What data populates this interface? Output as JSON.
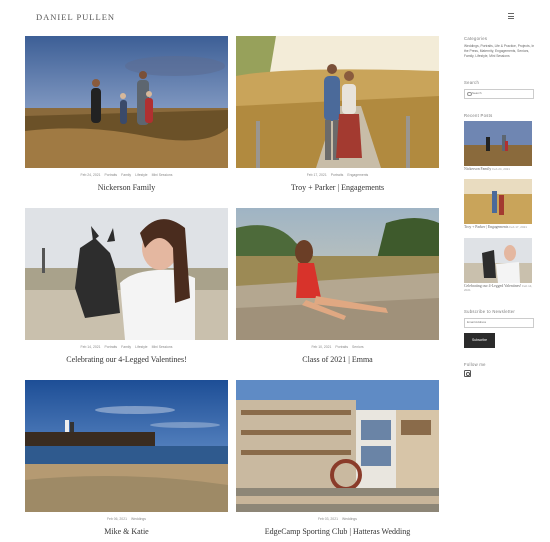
{
  "site": {
    "title": "DANIEL PULLEN"
  },
  "posts": [
    {
      "title": "Nickerson Family",
      "date": "Feb 24, 2021",
      "tags": [
        "Portraits",
        "Family",
        "Lifestyle",
        "Mini Sessions"
      ]
    },
    {
      "title": "Troy + Parker | Engagements",
      "date": "Feb 17, 2021",
      "tags": [
        "Portraits",
        "Engagements"
      ]
    },
    {
      "title": "Celebrating our 4-Legged Valentines!",
      "date": "Feb 14, 2021",
      "tags": [
        "Portraits",
        "Family",
        "Lifestyle",
        "Mini Sessions"
      ]
    },
    {
      "title": "Class of 2021 | Emma",
      "date": "Feb 10, 2021",
      "tags": [
        "Portraits",
        "Seniors"
      ]
    },
    {
      "title": "Mike & Katie",
      "date": "Feb 06, 2021",
      "tags": [
        "Weddings"
      ]
    },
    {
      "title": "EdgeCamp Sporting Club | Hatteras Wedding",
      "date": "Feb 03, 2021",
      "tags": [
        "Weddings"
      ]
    }
  ],
  "sidebar": {
    "categories_title": "Categories",
    "categories": [
      "Weddings",
      "Portraits",
      "Life & Practice",
      "Projects",
      "In the Press",
      "Maternity",
      "Engagements",
      "Seniors",
      "Family",
      "Lifestyle",
      "Mini Sessions"
    ],
    "search_title": "Search",
    "search_placeholder": "Search",
    "recent_title": "Recent Posts",
    "recent": [
      {
        "title": "Nickerson Family",
        "date": "Feb 24, 2021"
      },
      {
        "title": "Troy + Parker | Engagements",
        "date": "Feb 17, 2021"
      },
      {
        "title": "Celebrating our 4-Legged Valentines!",
        "date": "Feb 14, 2021"
      }
    ],
    "subscribe_title": "Subscribe to Newsletter",
    "email_placeholder": "Email Address",
    "subscribe_button": "Subscribe",
    "follow_title": "Follow me"
  },
  "icons": {
    "menu": "hamburger-icon",
    "search": "search-icon",
    "instagram": "instagram-icon"
  }
}
